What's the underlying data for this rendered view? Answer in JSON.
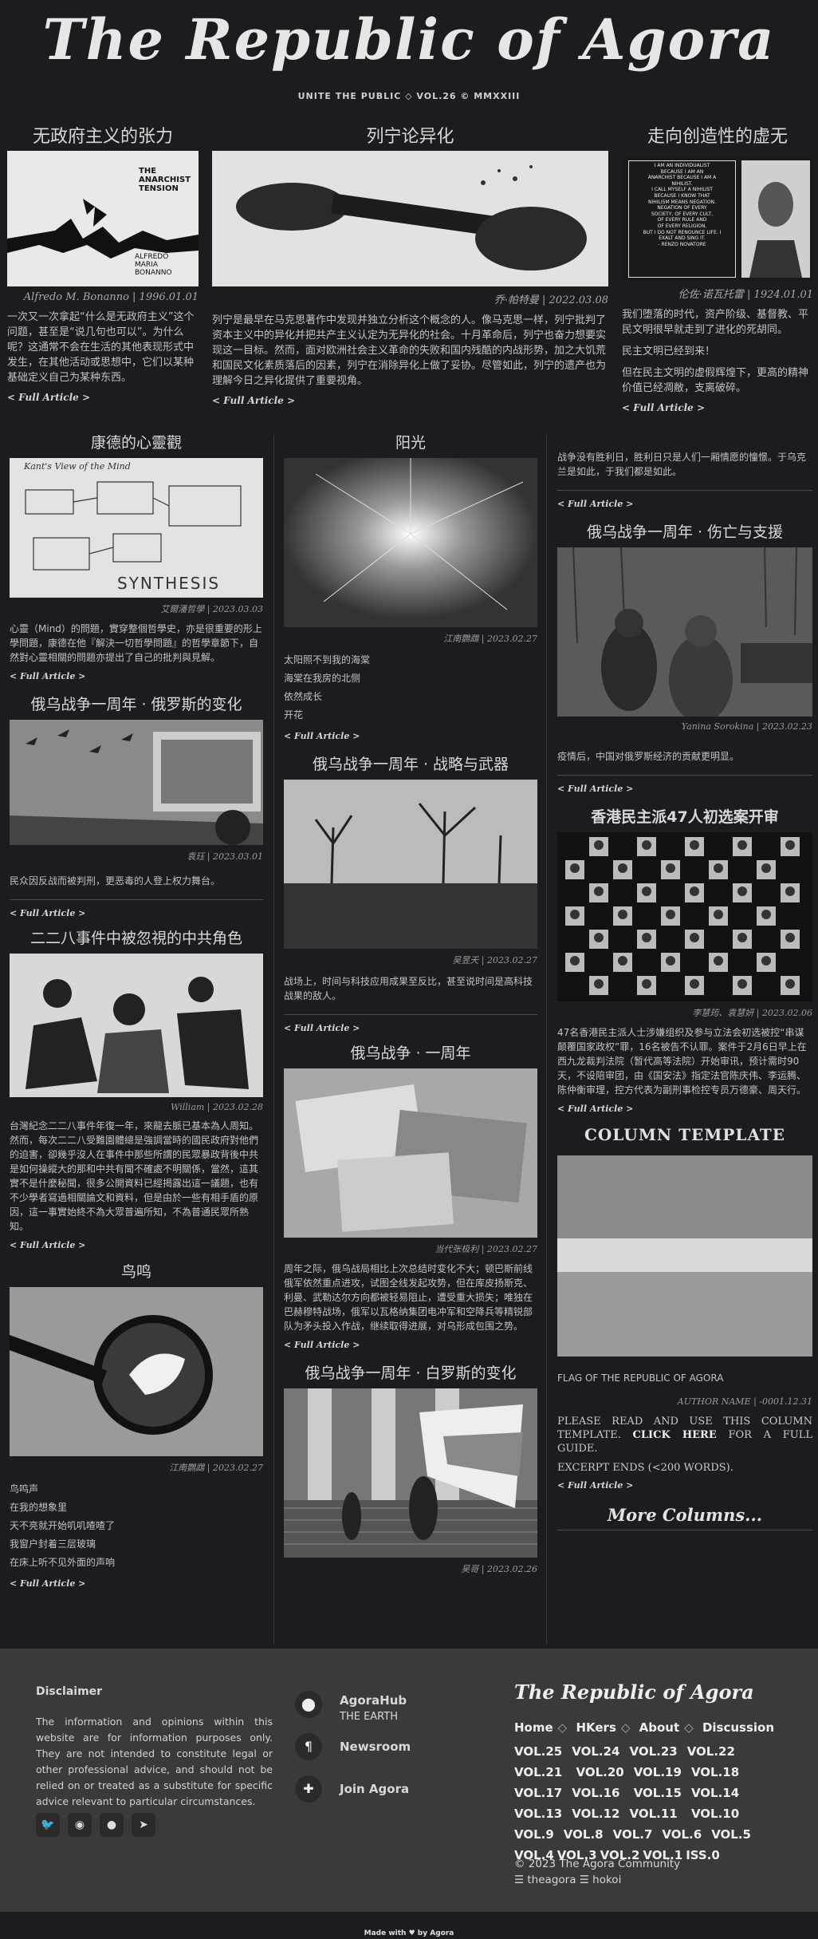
{
  "masthead": {
    "title": "The Republic of Agora",
    "subtitle": "UNITE THE PUBLIC ◇ VOL.26 © MMXXIII"
  },
  "featured": [
    {
      "title": "无政府主义的张力",
      "image_text": [
        "THE",
        "ANARCHIST",
        "TENSION",
        "ALFREDO",
        "MARIA",
        "BONANNO"
      ],
      "byline": "Alfredo M. Bonanno | 1996.01.01",
      "body": "一次又一次拿起“什么是无政府主义”这个问题，甚至是“说几句也可以”。为什么呢？这通常不会在生活的其他表现形式中发生，在其他活动或思想中，它们以某种基础定义自己为某种东西。",
      "more": "< Full Article >"
    },
    {
      "title": "列宁论异化",
      "byline": "乔·帕特曼 | 2022.03.08",
      "body": "列宁是最早在马克思著作中发现并独立分析这个概念的人。像马克思一样，列宁批判了资本主义中的异化并把共产主义认定为无异化的社会。十月革命后，列宁也奋力想要实现这一目标。然而，面对欧洲社会主义革命的失败和国内残酷的内战形势，加之大饥荒和国民文化素质落后的因素，列宁在消除异化上做了妥协。尽管如此，列宁的遗产也为理解今日之异化提供了重要视角。",
      "more": "< Full Article >"
    },
    {
      "title": "走向创造性的虚无",
      "image_text": [
        "I AM AN INDIVIDUALIST",
        "BECAUSE I AM AN",
        "ANARCHIST BECAUSE I AM A",
        "NIHILIST.",
        "I CALL MYSELF A NIHILIST",
        "BECAUSE I KNOW THAT",
        "NIHILISM MEANS NEGATION.",
        "NEGATION OF EVERY",
        "SOCIETY, OF EVERY CULT,",
        "OF EVERY RULE AND",
        "OF EVERY RELIGION.",
        "BUT I DO NOT RENOUNCE LIFE. I",
        "EXALT AND SING IT.",
        "- RENZO NOVATORE"
      ],
      "byline": "伦佐·诺瓦托雷 | 1924.01.01",
      "paragraphs": [
        "我们堕落的时代，资产阶级、基督教、平民文明很早就走到了进化的死胡同。",
        "民主文明已经到来！",
        "但在民主文明的虚假辉煌下，更高的精神价值已经凋敝，支离破碎。"
      ],
      "more": "< Full Article >"
    }
  ],
  "left_column": [
    {
      "title": "康德的心靈觀",
      "image_text": [
        "SYNTHESIS",
        "Kant's View of the Mind"
      ],
      "byline": "艾爾潘哲學 | 2023.03.03",
      "body": "心靈（Mind）的問題，實穿整個哲學史，亦是很重要的形上學問題，康德在他『解決一切哲學問題』的哲學章節下，自然對心靈相關的問題亦提出了自己的批判與見解。",
      "more": "< Full Article >"
    },
    {
      "title": "俄乌战争一周年 · 俄罗斯的变化",
      "byline": "袁珏 | 2023.03.01",
      "body": "民众因反战而被判刑，更恶毒的人登上权力舞台。",
      "more": "< Full Article >"
    },
    {
      "title": "二二八事件中被忽視的中共角色",
      "byline": "William | 2023.02.28",
      "body": "台灣紀念二二八事件年復一年，來龍去脈已基本為人周知。然而，每次二二八受難園體總是強調當時的國民政府對他們的迫害，卻幾乎沒人在事件中那些所謂的民眾暴政背後中共是如何操縱大的那和中共有聞不確處不明關係，當然，這其實不是什麼秘聞，很多公開資料已經揭露出這一議題，也有不少學者寫過相關論文和資料，但是由於一些有相手盾的原因，這一事實始終不為大眾普遍所知，不為普通民眾所熟知。",
      "more": "< Full Article >"
    },
    {
      "title": "鸟鸣",
      "byline": "江南鸚鵡 | 2023.02.27",
      "lines": [
        "鸟鸣声",
        "在我的想象里",
        "天不亮就开始叽叽喳喳了",
        "我窗户封着三层玻璃",
        "在床上听不见外面的声响"
      ],
      "more": "< Full Article >"
    }
  ],
  "middle_column": [
    {
      "title": "阳光",
      "byline": "江南鸚鵡 | 2023.02.27",
      "lines": [
        "太阳照不到我的海棠",
        "海棠在我房的北侧",
        "依然成长",
        "开花"
      ],
      "more": "< Full Article >"
    },
    {
      "title": "俄乌战争一周年 · 战略与武器",
      "byline": "吴昱天 | 2023.02.27",
      "body": "战场上，时间与科技应用成果至反比，甚至说时间是高科技战果的敌人。",
      "more": "< Full Article >"
    },
    {
      "title": "俄乌战争 · 一周年",
      "byline": "当代张极利 | 2023.02.27",
      "body": "周年之际，俄乌战局相比上次总结时变化不大；顿巴斯前线俄军依然重点进攻，试图全线发起攻势，但在库皮扬斯克、利曼、武勒达尔方向都被轻易阻止，遭受重大损失；唯独在巴赫穆特战场，俄军以瓦格纳集团电冲军和空降兵等精锐部队为矛头投入作战，继续取得进展，对乌形成包围之势。",
      "more": "< Full Article >"
    },
    {
      "title": "俄乌战争一周年 · 白罗斯的变化",
      "byline": "吴哥 | 2023.02.26"
    }
  ],
  "right_column": [
    {
      "body": "战争没有胜利日，胜利日只是人们一厢情愿的憧憬。于乌克兰是如此，于我们都是如此。",
      "more": "< Full Article >"
    },
    {
      "title": "俄乌战争一周年 · 伤亡与支援",
      "byline": "Yanina Sorokina | 2023.02.23",
      "body": "疫情后，中国对俄罗斯经济的贡献更明显。",
      "more": "< Full Article >"
    },
    {
      "title": "香港民主派47人初选案开审",
      "byline": "李慧筠、袁慧妍 | 2023.02.06",
      "body": "47名香港民主派人士涉嫌组织及参与立法会初选被控“串谋颠覆国家政权”罪，16名被告不认罪。案件于2月6日早上在西九龙裁判法院（暂代高等法院）开始审讯，预计需时90天，不设陪审团，由《国安法》指定法官陈庆伟、李运腾、陈仲衡审理，控方代表为副刑事检控专员万德豪、周天行。",
      "more": "< Full Article >"
    },
    {
      "title": "COLUMN TEMPLATE",
      "caption": "FLAG OF THE REPUBLIC OF AGORA",
      "byline": "AUTHOR NAME | -0001.12.31",
      "body_1": "PLEASE READ AND USE THIS COLUMN TEMPLATE.",
      "body_link": "CLICK HERE",
      "body_2": "FOR A FULL GUIDE.",
      "body_3": "EXCERPT ENDS (<200 WORDS).",
      "more": "< Full Article >"
    }
  ],
  "more_columns": "More Columns...",
  "footer": {
    "disclaimer_title": "Disclaimer",
    "disclaimer": "The information and opinions within this website are for information purposes only. They are not intended to constitute legal or other professional advice, and should not be relied on or treated as a substitute for specific advice relevant to particular circumstances.",
    "hub": [
      {
        "title": "AgoraHub",
        "sub": "THE EARTH",
        "icon": "location-pin-icon"
      },
      {
        "title": "Newsroom",
        "sub": "",
        "icon": "pilcrow-icon"
      },
      {
        "title": "Join Agora",
        "sub": "",
        "icon": "puzzle-icon"
      }
    ],
    "logo": "The Republic of Agora",
    "nav": [
      "Home",
      "HKers",
      "About",
      "Discussion"
    ],
    "vols": [
      "VOL.25",
      "VOL.24",
      "VOL.23",
      "VOL.22",
      "VOL.21",
      "VOL.20",
      "VOL.19",
      "VOL.18",
      "VOL.17",
      "VOL.16",
      "VOL.15",
      "VOL.14",
      "VOL.13",
      "VOL.12",
      "VOL.11",
      "VOL.10",
      "VOL.9",
      "VOL.8",
      "VOL.7",
      "VOL.6",
      "VOL.5",
      "VOL.4",
      "VOL.3",
      "VOL.2",
      "VOL.1",
      "ISS.0"
    ],
    "copyright": "© 2023 The Agora Community",
    "users": "☰ theagora ☰ hokoi",
    "made_with": "Made with ♥ by Agora"
  }
}
